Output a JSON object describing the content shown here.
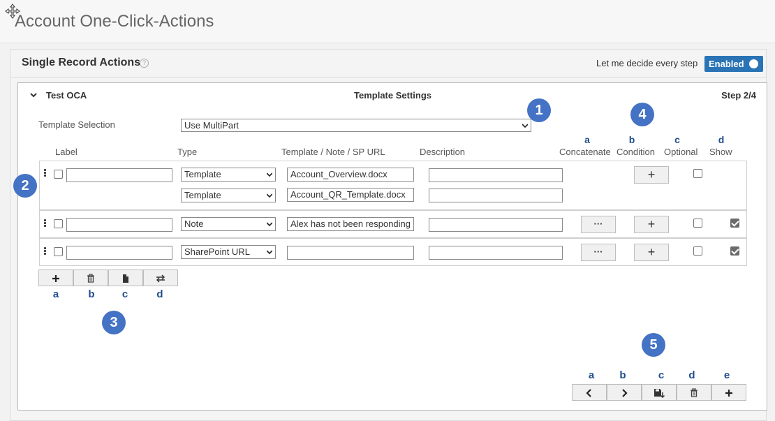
{
  "page": {
    "title": "Account One-Click-Actions"
  },
  "panel": {
    "title": "Single Record Actions",
    "decide_label": "Let me decide every step",
    "toggle_label": "Enabled"
  },
  "card": {
    "name": "Test OCA",
    "section_title": "Template Settings",
    "step": "Step 2/4"
  },
  "template_selection": {
    "label": "Template Selection",
    "value": "Use MultiPart"
  },
  "columns": {
    "label": "Label",
    "type": "Type",
    "url": "Template / Note / SP URL",
    "description": "Description",
    "concatenate": "Concatenate",
    "condition": "Condition",
    "optional": "Optional",
    "show": "Show"
  },
  "column_letters": [
    "a",
    "b",
    "c",
    "d"
  ],
  "rows": [
    {
      "label": "",
      "type": "Template",
      "value": "Account_Overview.docx",
      "description": "",
      "optional": false,
      "show": null
    },
    {
      "type": "Template",
      "value": "Account_QR_Template.docx",
      "description": ""
    },
    {
      "label": "",
      "type": "Note",
      "value": "Alex has not been responding",
      "description": "",
      "optional": false,
      "show": true
    },
    {
      "label": "",
      "type": "SharePoint URL",
      "value": "",
      "description": "",
      "optional": false,
      "show": true
    }
  ],
  "buttons": {
    "concat": "···",
    "add": "+"
  },
  "toolbar_letters": [
    "a",
    "b",
    "c",
    "d"
  ],
  "nav_letters": [
    "a",
    "b",
    "c",
    "d",
    "e"
  ],
  "badges": [
    "1",
    "2",
    "3",
    "4",
    "5"
  ],
  "colors": {
    "accent": "#4472c4",
    "toggle": "#2a74b5",
    "letters": "#1f4e8c"
  }
}
